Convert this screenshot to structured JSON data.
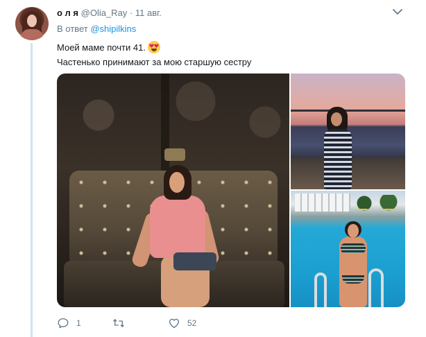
{
  "tweet": {
    "display_name": "о л я",
    "handle": "@Olia_Ray",
    "separator": "·",
    "date": "11 авг.",
    "reply_prefix": "В ответ",
    "reply_mention": "@shipilkins",
    "text_line1": "Моей маме почти 41.",
    "text_line2": "Частенько принимают за мою старшую сестру",
    "emoji": "heart-eyes-emoji"
  },
  "actions": {
    "reply_count": "1",
    "retweet_count": "",
    "like_count": "52"
  },
  "colors": {
    "link": "#1b95e0",
    "secondary_text": "#657786",
    "thread_line": "#cce4f7"
  }
}
